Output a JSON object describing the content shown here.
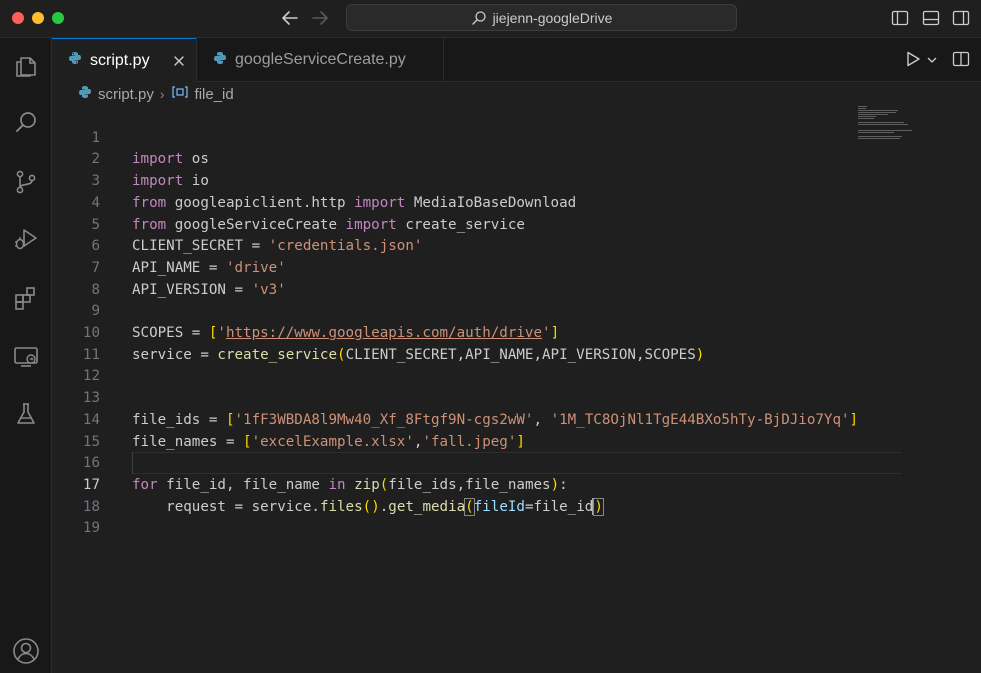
{
  "window": {
    "search_text": "jiejenn-googleDrive"
  },
  "tabs": [
    {
      "label": "script.py",
      "active": true
    },
    {
      "label": "googleServiceCreate.py",
      "active": false
    }
  ],
  "breadcrumb": {
    "file": "script.py",
    "symbol": "file_id"
  },
  "editor": {
    "current_line": 17,
    "lines": [
      {
        "n": "1"
      },
      {
        "n": "2"
      },
      {
        "n": "3"
      },
      {
        "n": "4"
      },
      {
        "n": "5"
      },
      {
        "n": "6"
      },
      {
        "n": "7"
      },
      {
        "n": "8"
      },
      {
        "n": "9"
      },
      {
        "n": "10"
      },
      {
        "n": "11"
      },
      {
        "n": "12"
      },
      {
        "n": "13"
      },
      {
        "n": "14"
      },
      {
        "n": "15"
      },
      {
        "n": "16"
      },
      {
        "n": "17"
      },
      {
        "n": "18"
      },
      {
        "n": "19"
      }
    ],
    "code": {
      "l1": {
        "kw": "import",
        "rest": " os"
      },
      "l2": {
        "kw": "import",
        "rest": " io"
      },
      "l3": {
        "kw1": "from",
        "mod": " googleapiclient.http ",
        "kw2": "import",
        "rest": " MediaIoBaseDownload"
      },
      "l4": {
        "kw1": "from",
        "mod": " googleServiceCreate ",
        "kw2": "import",
        "rest": " create_service"
      },
      "l5": {
        "name": "CLIENT_SECRET",
        "op": " = ",
        "str": "'credentials.json'"
      },
      "l6": {
        "name": "API_NAME",
        "op": " = ",
        "str": "'drive'"
      },
      "l7": {
        "name": "API_VERSION",
        "op": " = ",
        "str": "'v3'"
      },
      "l9": {
        "name": "SCOPES",
        "op": " = ",
        "open": "[",
        "q1": "'",
        "url": "https://www.googleapis.com/auth/drive",
        "q2": "'",
        "close": "]"
      },
      "l10": {
        "name": "service",
        "op": " = ",
        "fn": "create_service",
        "open": "(",
        "args": "CLIENT_SECRET,API_NAME,API_VERSION,SCOPES",
        "close": ")"
      },
      "l13": {
        "name": "file_ids",
        "op": " = ",
        "open": "[",
        "s1": "'1fF3WBDA8l9Mw40_Xf_8Ftgf9N-cgs2wW'",
        "sep": ", ",
        "s2": "'1M_TC8OjNl1TgE44BXo5hTy-BjDJio7Yq'",
        "close": "]"
      },
      "l14": {
        "name": "file_names",
        "op": " = ",
        "open": "[",
        "s1": "'excelExample.xlsx'",
        "sep": ",",
        "s2": "'fall.jpeg'",
        "close": "]"
      },
      "l16": {
        "kw1": "for",
        "v1": " file_id, file_name ",
        "kw2": "in",
        "sp": " ",
        "fn": "zip",
        "open": "(",
        "args": "file_ids,file_names",
        "close": ")",
        "colon": ":"
      },
      "l17": {
        "indent": "    ",
        "name": "request",
        "op": " = ",
        "obj": "service.",
        "fn1": "files",
        "p1": "()",
        "dot": ".",
        "fn2": "get_media",
        "open": "(",
        "param": "fileId",
        "eq": "=",
        "arg": "file_id",
        "close": ")"
      }
    }
  },
  "icons": {
    "activity": [
      "explorer-icon",
      "search-icon",
      "source-control-icon",
      "run-debug-icon",
      "extensions-icon",
      "remote-explorer-icon",
      "testing-icon",
      "accounts-icon"
    ]
  }
}
